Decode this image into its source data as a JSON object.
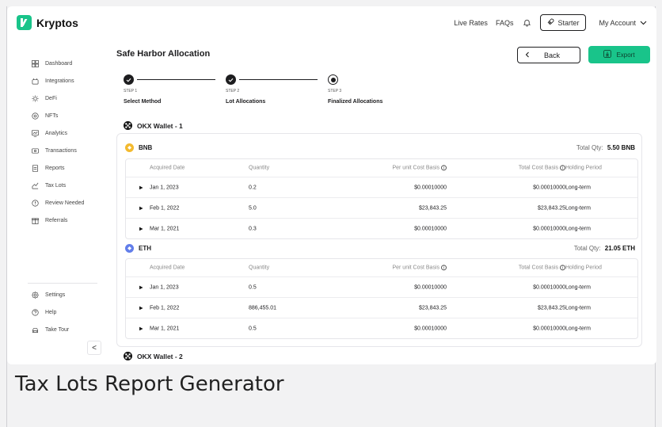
{
  "app": {
    "name": "Kryptos"
  },
  "topnav": {
    "live_rates": "Live Rates",
    "faqs": "FAQs",
    "plan": "Starter",
    "account": "My Account"
  },
  "sidebar": {
    "items": [
      {
        "label": "Dashboard",
        "icon": "dashboard-icon"
      },
      {
        "label": "Integrations",
        "icon": "integrations-icon"
      },
      {
        "label": "DeFi",
        "icon": "defi-icon"
      },
      {
        "label": "NFTs",
        "icon": "nft-icon"
      },
      {
        "label": "Analytics",
        "icon": "analytics-icon"
      },
      {
        "label": "Transactions",
        "icon": "transactions-icon"
      },
      {
        "label": "Reports",
        "icon": "reports-icon"
      },
      {
        "label": "Tax Lots",
        "icon": "tax-lots-icon"
      },
      {
        "label": "Review Needed",
        "icon": "review-icon"
      },
      {
        "label": "Referrals",
        "icon": "referrals-icon"
      }
    ],
    "bottom": [
      {
        "label": "Settings",
        "icon": "settings-icon"
      },
      {
        "label": "Help",
        "icon": "help-icon"
      },
      {
        "label": "Take Tour",
        "icon": "tour-icon"
      }
    ],
    "collapse": "<"
  },
  "page": {
    "title": "Safe Harbor Allocation",
    "back": "Back",
    "export": "Export"
  },
  "steps": [
    {
      "no": "STEP 1",
      "name": "Select Method",
      "state": "done"
    },
    {
      "no": "STEP 2",
      "name": "Lot Allocations",
      "state": "done"
    },
    {
      "no": "STEP 3",
      "name": "Finalized Allocations",
      "state": "active"
    }
  ],
  "table_headers": {
    "acquired": "Acquired Date",
    "quantity": "Quantity",
    "unit_cost": "Per unit Cost Basis",
    "total_cost": "Total Cost Basis",
    "holding": "Holding Period"
  },
  "wallets": [
    {
      "name": "OKX Wallet - 1",
      "coins": [
        {
          "symbol": "BNB",
          "total_label": "Total Qty:",
          "total_value": "5.50 BNB",
          "color": "#f3ba2f",
          "rows": [
            {
              "date": "Jan 1, 2023",
              "qty": "0.2",
              "unit": "$0.00010000",
              "total": "$0.00010000",
              "holding": "Long-term"
            },
            {
              "date": "Feb 1, 2022",
              "qty": "5.0",
              "unit": "$23,843.25",
              "total": "$23,843.25",
              "holding": "Long-term"
            },
            {
              "date": "Mar 1, 2021",
              "qty": "0.3",
              "unit": "$0.00010000",
              "total": "$0.00010000",
              "holding": "Long-term"
            }
          ]
        },
        {
          "symbol": "ETH",
          "total_label": "Total Qty:",
          "total_value": "21.05 ETH",
          "color": "#627eea",
          "rows": [
            {
              "date": "Jan 1, 2023",
              "qty": "0.5",
              "unit": "$0.00010000",
              "total": "$0.00010000",
              "holding": "Long-term"
            },
            {
              "date": "Feb 1, 2022",
              "qty": "886,455.01",
              "unit": "$23,843.25",
              "total": "$23,843.25",
              "holding": "Long-term"
            },
            {
              "date": "Mar 1, 2021",
              "qty": "0.5",
              "unit": "$0.00010000",
              "total": "$0.00010000",
              "holding": "Long-term"
            }
          ]
        }
      ]
    },
    {
      "name": "OKX Wallet - 2"
    }
  ],
  "caption": "Tax Lots Report Generator",
  "colors": {
    "accent": "#19c48a"
  }
}
